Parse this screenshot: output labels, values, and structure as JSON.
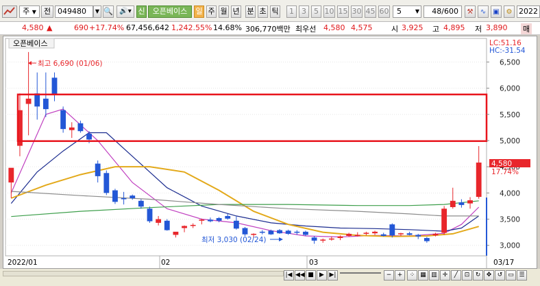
{
  "toolbar": {
    "code_type": "주",
    "prev_label": "전",
    "stock_code": "049480",
    "badge_new": "신",
    "stock_name": "오픈베이스",
    "period_day": "일",
    "period_week": "주",
    "period_month": "월",
    "period_year": "년",
    "period_minute": "분",
    "period_second": "초",
    "period_tick": "틱",
    "intervals": [
      "1",
      "3",
      "5",
      "10",
      "15",
      "30",
      "45",
      "60"
    ],
    "interval_value": "5",
    "count_value": "48",
    "count_total": "/600",
    "date_value": "2022"
  },
  "quote": {
    "price": "4,580",
    "change_arrow": "▲",
    "change": "690",
    "change_pct": "+17.74%",
    "volume": "67,456,642",
    "volume_pct": "1,242.55%",
    "turnover": "14.68%",
    "amount": "306,770백만",
    "best_ask_label": "최우선",
    "best_ask": "4,580",
    "best_bid": "4,575",
    "open_label": "시",
    "open": "3,925",
    "high_label": "고",
    "high": "4,895",
    "low_label": "저",
    "low": "3,890",
    "extra_label": "매"
  },
  "chart": {
    "title": "오픈베이스",
    "lc_label": "LC:51.16",
    "hc_label": "HC:-31.54",
    "high_annotation": "최고 6,690 (01/06)",
    "low_annotation": "최저 3,030 (02/24)",
    "current_price_tag": "4,580",
    "current_pct_tag": "17.74%",
    "y_ticks": [
      "6,500",
      "6,000",
      "5,500",
      "5,000",
      "4,500",
      "4,000",
      "3,500",
      "3,000"
    ],
    "x_ticks": [
      "2022/01",
      "02",
      "03",
      "03/17"
    ]
  },
  "chart_data": {
    "type": "candlestick",
    "title": "오픈베이스",
    "ylim": [
      2800,
      6950
    ],
    "up_color": "#e8262b",
    "down_color": "#2357d6",
    "candles": [
      {
        "o": 4200,
        "h": 4450,
        "l": 3900,
        "c": 4480
      },
      {
        "o": 4900,
        "h": 5900,
        "l": 4700,
        "c": 5580
      },
      {
        "o": 5700,
        "h": 6690,
        "l": 5100,
        "c": 5800
      },
      {
        "o": 5900,
        "h": 6300,
        "l": 5400,
        "c": 5650
      },
      {
        "o": 5800,
        "h": 6300,
        "l": 5450,
        "c": 5600
      },
      {
        "o": 6200,
        "h": 6300,
        "l": 5750,
        "c": 5870
      },
      {
        "o": 5580,
        "h": 5650,
        "l": 5150,
        "c": 5220
      },
      {
        "o": 5200,
        "h": 5350,
        "l": 5050,
        "c": 5250
      },
      {
        "o": 5330,
        "h": 5380,
        "l": 5150,
        "c": 5180
      },
      {
        "o": 5130,
        "h": 5180,
        "l": 4950,
        "c": 5020
      },
      {
        "o": 4560,
        "h": 4620,
        "l": 4200,
        "c": 4320
      },
      {
        "o": 4380,
        "h": 4430,
        "l": 3960,
        "c": 4000
      },
      {
        "o": 4050,
        "h": 4080,
        "l": 3790,
        "c": 3830
      },
      {
        "o": 3900,
        "h": 4020,
        "l": 3780,
        "c": 3880
      },
      {
        "o": 3950,
        "h": 3970,
        "l": 3870,
        "c": 3900
      },
      {
        "o": 3850,
        "h": 3880,
        "l": 3700,
        "c": 3740
      },
      {
        "o": 3700,
        "h": 3740,
        "l": 3430,
        "c": 3460
      },
      {
        "o": 3430,
        "h": 3560,
        "l": 3380,
        "c": 3500
      },
      {
        "o": 3470,
        "h": 3500,
        "l": 3280,
        "c": 3290
      },
      {
        "o": 3200,
        "h": 3250,
        "l": 3150,
        "c": 3260
      },
      {
        "o": 3330,
        "h": 3380,
        "l": 3250,
        "c": 3370
      },
      {
        "o": 3380,
        "h": 3420,
        "l": 3330,
        "c": 3390
      },
      {
        "o": 3470,
        "h": 3510,
        "l": 3400,
        "c": 3490
      },
      {
        "o": 3490,
        "h": 3530,
        "l": 3440,
        "c": 3460
      },
      {
        "o": 3520,
        "h": 3540,
        "l": 3440,
        "c": 3470
      },
      {
        "o": 3560,
        "h": 3600,
        "l": 3490,
        "c": 3510
      },
      {
        "o": 3470,
        "h": 3550,
        "l": 3300,
        "c": 3320
      },
      {
        "o": 3330,
        "h": 3350,
        "l": 3180,
        "c": 3210
      },
      {
        "o": 3200,
        "h": 3230,
        "l": 3140,
        "c": 3220
      },
      {
        "o": 3260,
        "h": 3290,
        "l": 3210,
        "c": 3240
      },
      {
        "o": 3280,
        "h": 3300,
        "l": 3200,
        "c": 3210
      },
      {
        "o": 3290,
        "h": 3310,
        "l": 3220,
        "c": 3230
      },
      {
        "o": 3280,
        "h": 3300,
        "l": 3200,
        "c": 3220
      },
      {
        "o": 3260,
        "h": 3290,
        "l": 3200,
        "c": 3250
      },
      {
        "o": 3260,
        "h": 3280,
        "l": 3180,
        "c": 3200
      },
      {
        "o": 3150,
        "h": 3180,
        "l": 3030,
        "c": 3090
      },
      {
        "o": 3090,
        "h": 3130,
        "l": 3050,
        "c": 3110
      },
      {
        "o": 3120,
        "h": 3170,
        "l": 3090,
        "c": 3130
      },
      {
        "o": 3140,
        "h": 3190,
        "l": 3100,
        "c": 3170
      },
      {
        "o": 3180,
        "h": 3240,
        "l": 3160,
        "c": 3220
      },
      {
        "o": 3190,
        "h": 3250,
        "l": 3170,
        "c": 3200
      },
      {
        "o": 3220,
        "h": 3260,
        "l": 3190,
        "c": 3240
      },
      {
        "o": 3230,
        "h": 3280,
        "l": 3200,
        "c": 3260
      },
      {
        "o": 3210,
        "h": 3240,
        "l": 3170,
        "c": 3180
      },
      {
        "o": 3400,
        "h": 3420,
        "l": 3150,
        "c": 3190
      },
      {
        "o": 3210,
        "h": 3240,
        "l": 3180,
        "c": 3230
      },
      {
        "o": 3230,
        "h": 3260,
        "l": 3190,
        "c": 3200
      },
      {
        "o": 3200,
        "h": 3220,
        "l": 3120,
        "c": 3170
      },
      {
        "o": 3140,
        "h": 3160,
        "l": 3050,
        "c": 3080
      },
      {
        "o": 3190,
        "h": 3240,
        "l": 3170,
        "c": 3220
      },
      {
        "o": 3240,
        "h": 3750,
        "l": 3200,
        "c": 3700
      },
      {
        "o": 3730,
        "h": 4100,
        "l": 3700,
        "c": 3850
      },
      {
        "o": 3820,
        "h": 3880,
        "l": 3720,
        "c": 3770
      },
      {
        "o": 3800,
        "h": 3920,
        "l": 3700,
        "c": 3860
      },
      {
        "o": 3925,
        "h": 4895,
        "l": 3890,
        "c": 4580
      }
    ],
    "ma_series": [
      {
        "color": "#c040c0",
        "values": [
          [
            0,
            4000
          ],
          [
            4,
            5500
          ],
          [
            6,
            5600
          ],
          [
            10,
            5000
          ],
          [
            14,
            4200
          ],
          [
            18,
            3700
          ],
          [
            22,
            3500
          ],
          [
            26,
            3430
          ],
          [
            30,
            3280
          ],
          [
            34,
            3180
          ],
          [
            38,
            3160
          ],
          [
            42,
            3190
          ],
          [
            46,
            3180
          ],
          [
            50,
            3230
          ],
          [
            52,
            3400
          ],
          [
            54,
            3730
          ]
        ]
      },
      {
        "color": "#1b2c8f",
        "values": [
          [
            0,
            3800
          ],
          [
            3,
            4400
          ],
          [
            6,
            4800
          ],
          [
            9,
            5150
          ],
          [
            11,
            5150
          ],
          [
            14,
            4700
          ],
          [
            18,
            4100
          ],
          [
            22,
            3750
          ],
          [
            26,
            3560
          ],
          [
            30,
            3430
          ],
          [
            34,
            3370
          ],
          [
            38,
            3330
          ],
          [
            42,
            3320
          ],
          [
            46,
            3300
          ],
          [
            50,
            3270
          ],
          [
            52,
            3330
          ],
          [
            54,
            3560
          ]
        ]
      },
      {
        "color": "#e3a91a",
        "values": [
          [
            0,
            3900
          ],
          [
            4,
            4150
          ],
          [
            8,
            4350
          ],
          [
            12,
            4500
          ],
          [
            16,
            4500
          ],
          [
            20,
            4400
          ],
          [
            24,
            4050
          ],
          [
            28,
            3650
          ],
          [
            32,
            3400
          ],
          [
            36,
            3250
          ],
          [
            40,
            3190
          ],
          [
            44,
            3170
          ],
          [
            48,
            3180
          ],
          [
            51,
            3220
          ],
          [
            54,
            3360
          ]
        ]
      },
      {
        "color": "#3c9e4a",
        "values": [
          [
            0,
            3550
          ],
          [
            8,
            3650
          ],
          [
            16,
            3720
          ],
          [
            24,
            3780
          ],
          [
            32,
            3780
          ],
          [
            40,
            3760
          ],
          [
            46,
            3760
          ],
          [
            50,
            3780
          ],
          [
            54,
            3850
          ]
        ]
      },
      {
        "color": "#8b8b8b",
        "values": [
          [
            0,
            4030
          ],
          [
            8,
            3950
          ],
          [
            16,
            3880
          ],
          [
            24,
            3780
          ],
          [
            32,
            3700
          ],
          [
            40,
            3650
          ],
          [
            46,
            3600
          ],
          [
            50,
            3560
          ],
          [
            54,
            3560
          ]
        ]
      }
    ],
    "highlight_band": [
      4990,
      5880
    ]
  }
}
